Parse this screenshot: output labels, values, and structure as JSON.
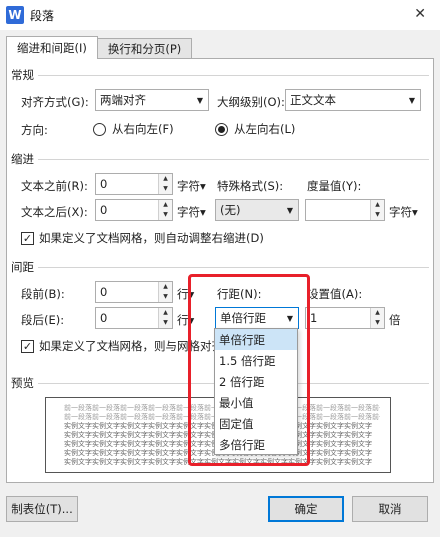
{
  "window": {
    "title": "段落",
    "app_icon_letter": "W",
    "close_label": "✕"
  },
  "tabs": [
    {
      "label": "缩进和间距(I)"
    },
    {
      "label": "换行和分页(P)"
    }
  ],
  "general": {
    "section_label": "常规",
    "alignment_label": "对齐方式(G):",
    "alignment_value": "两端对齐",
    "outline_label": "大纲级别(O):",
    "outline_value": "正文文本",
    "direction_label": "方向:",
    "rtl_label": "从右向左(F)",
    "ltr_label": "从左向右(L)"
  },
  "indent": {
    "section_label": "缩进",
    "before_label": "文本之前(R):",
    "before_value": "0",
    "before_unit": "字符▾",
    "after_label": "文本之后(X):",
    "after_value": "0",
    "after_unit": "字符▾",
    "special_label": "特殊格式(S):",
    "special_value": "(无)",
    "measure_label": "度量值(Y):",
    "measure_value": "",
    "measure_unit": "字符▾",
    "grid_check_label": "如果定义了文档网格，则自动调整右缩进(D)",
    "grid_check_mark": "✓"
  },
  "spacing": {
    "section_label": "间距",
    "before_label": "段前(B):",
    "before_value": "0",
    "before_unit": "行▾",
    "after_label": "段后(E):",
    "after_value": "0",
    "after_unit": "行▾",
    "line_label": "行距(N):",
    "line_value": "单倍行距",
    "setting_label": "设置值(A):",
    "setting_value": "1",
    "setting_unit": "倍",
    "grid_check_label": "如果定义了文档网格，则与网格对齐",
    "grid_check_mark": "✓"
  },
  "line_spacing_options": [
    "单倍行距",
    "1.5 倍行距",
    "2 倍行距",
    "最小值",
    "固定值",
    "多倍行距"
  ],
  "preview": {
    "section_label": "预览",
    "prev_text": "前一段落前一段落前一段落前一段落前一段落前一段落前一段落前一段落前一段落前一段落前一段落前一段落",
    "sample_text": "实例文字实例文字实例文字实例文字实例文字实例文字实例文字实例文字实例文字实例文字实例文字"
  },
  "buttons": {
    "tabs_label": "制表位(T)...",
    "ok_label": "确定",
    "cancel_label": "取消"
  },
  "colors": {
    "highlight": "#e8202a",
    "selection": "#cce4f7",
    "accent": "#0078d7"
  }
}
